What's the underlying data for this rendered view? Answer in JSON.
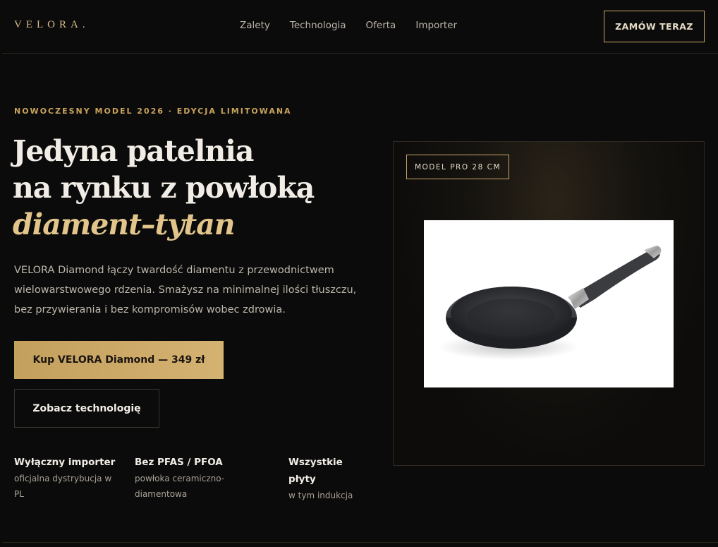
{
  "header": {
    "logo": "VELORA.",
    "nav": [
      "Zalety",
      "Technologia",
      "Oferta",
      "Importer"
    ],
    "cta": "ZAMÓW TERAZ"
  },
  "hero": {
    "eyebrow": "NOWOCZESNY MODEL 2026 · EDYCJA LIMITOWANA",
    "title_line1": "Jedyna patelnia",
    "title_line2": "na rynku z powłoką",
    "title_accent": "diament–tytan",
    "lead": "VELORA Diamond łączy twardość diamentu z przewodnictwem wielowarstwowego rdzenia. Smażysz na minimalnej ilości tłuszczu, bez przywierania i bez kompromisów wobec zdrowia.",
    "primary_button": "Kup VELORA Diamond — 349 zł",
    "secondary_button": "Zobacz technologię"
  },
  "features": [
    {
      "title": "Wyłączny importer",
      "desc": "oficjalna dystrybucja w PL"
    },
    {
      "title": "Bez PFAS / PFOA",
      "desc": "powłoka ceramiczno-diamentowa"
    },
    {
      "title": "Wszystkie płyty",
      "desc": "w tym indukcja"
    }
  ],
  "product": {
    "badge": "MODEL PRO 28 CM",
    "image_icon": "frying-pan-icon"
  },
  "colors": {
    "background": "#0b0b0b",
    "accent_gold": "#c9a35c",
    "accent_italic": "#e2c58a",
    "text_primary": "#f1ede6"
  }
}
